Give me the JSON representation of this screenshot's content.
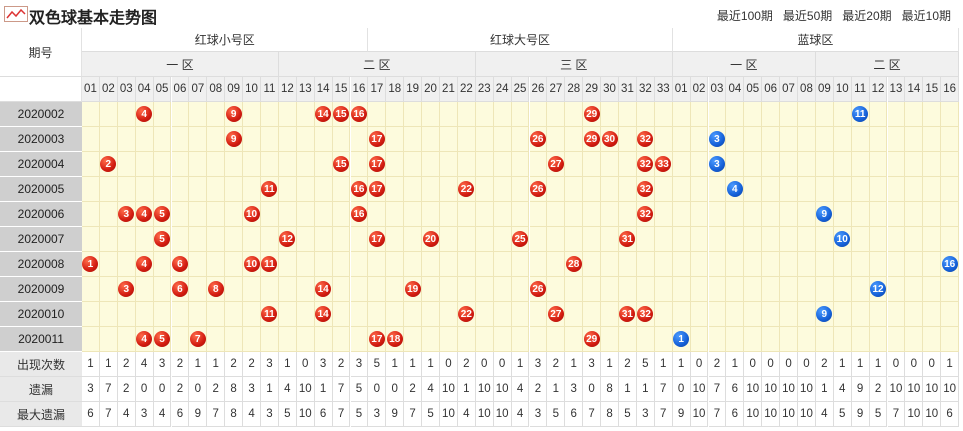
{
  "title": "双色球基本走势图",
  "periods": [
    "最近100期",
    "最近50期",
    "最近20期",
    "最近10期"
  ],
  "issue_header": "期号",
  "groups": [
    "红球小号区",
    "红球大号区",
    "蓝球区"
  ],
  "zones": [
    "一 区",
    "二 区",
    "三 区",
    "一 区",
    "二 区"
  ],
  "red_labels": [
    "01",
    "02",
    "03",
    "04",
    "05",
    "06",
    "07",
    "08",
    "09",
    "10",
    "11",
    "12",
    "13",
    "14",
    "15",
    "16",
    "17",
    "18",
    "19",
    "20",
    "21",
    "22",
    "23",
    "24",
    "25",
    "26",
    "27",
    "28",
    "29",
    "30",
    "31",
    "32",
    "33"
  ],
  "blue_labels": [
    "01",
    "02",
    "03",
    "04",
    "05",
    "06",
    "07",
    "08",
    "09",
    "10",
    "11",
    "12",
    "13",
    "14",
    "15",
    "16"
  ],
  "rows": [
    {
      "issue": "2020002",
      "red": [
        4,
        9,
        14,
        15,
        16,
        29
      ],
      "blue": 11
    },
    {
      "issue": "2020003",
      "red": [
        9,
        17,
        26,
        29,
        30,
        32
      ],
      "blue": 3
    },
    {
      "issue": "2020004",
      "red": [
        2,
        15,
        17,
        27,
        32,
        33
      ],
      "blue": 3
    },
    {
      "issue": "2020005",
      "red": [
        11,
        16,
        17,
        22,
        26,
        32
      ],
      "blue": 4
    },
    {
      "issue": "2020006",
      "red": [
        3,
        4,
        5,
        10,
        16,
        32
      ],
      "blue": 9
    },
    {
      "issue": "2020007",
      "red": [
        5,
        12,
        17,
        20,
        25,
        31
      ],
      "blue": 10
    },
    {
      "issue": "2020008",
      "red": [
        1,
        4,
        6,
        10,
        11,
        28
      ],
      "blue": 16
    },
    {
      "issue": "2020009",
      "red": [
        3,
        6,
        8,
        14,
        19,
        26
      ],
      "blue": 12
    },
    {
      "issue": "2020010",
      "red": [
        11,
        14,
        22,
        27,
        31,
        32
      ],
      "blue": 9
    },
    {
      "issue": "2020011",
      "red": [
        4,
        5,
        7,
        17,
        18,
        29
      ],
      "blue": 1
    }
  ],
  "stats": [
    {
      "label": "出现次数",
      "values": [
        1,
        1,
        2,
        4,
        3,
        2,
        1,
        1,
        2,
        2,
        3,
        1,
        0,
        3,
        2,
        3,
        5,
        1,
        1,
        1,
        0,
        2,
        0,
        0,
        1,
        3,
        2,
        1,
        3,
        1,
        2,
        5,
        1,
        1,
        0,
        2,
        1,
        0,
        0,
        0,
        0,
        2,
        1,
        1,
        1,
        0,
        0,
        0,
        1
      ]
    },
    {
      "label": "遗漏",
      "values": [
        3,
        7,
        2,
        0,
        0,
        2,
        0,
        2,
        8,
        3,
        1,
        4,
        10,
        1,
        7,
        5,
        0,
        0,
        2,
        4,
        10,
        1,
        10,
        10,
        4,
        2,
        1,
        3,
        0,
        8,
        1,
        1,
        7,
        0,
        10,
        7,
        6,
        10,
        10,
        10,
        10,
        1,
        4,
        9,
        2,
        10,
        10,
        10,
        10
      ]
    },
    {
      "label": "最大遗漏",
      "values": [
        6,
        7,
        4,
        3,
        4,
        6,
        9,
        7,
        8,
        4,
        3,
        5,
        10,
        6,
        7,
        5,
        3,
        9,
        7,
        5,
        10,
        4,
        10,
        10,
        4,
        3,
        5,
        6,
        7,
        8,
        5,
        3,
        7,
        9,
        10,
        7,
        6,
        10,
        10,
        10,
        10,
        4,
        5,
        9,
        5,
        7,
        10,
        10,
        6
      ]
    }
  ],
  "colors": {
    "red_ball": "#d21b10",
    "blue_ball": "#1560d8",
    "cell_bg": "#fdfbdd",
    "issue_bg": "#cfcfcf"
  }
}
